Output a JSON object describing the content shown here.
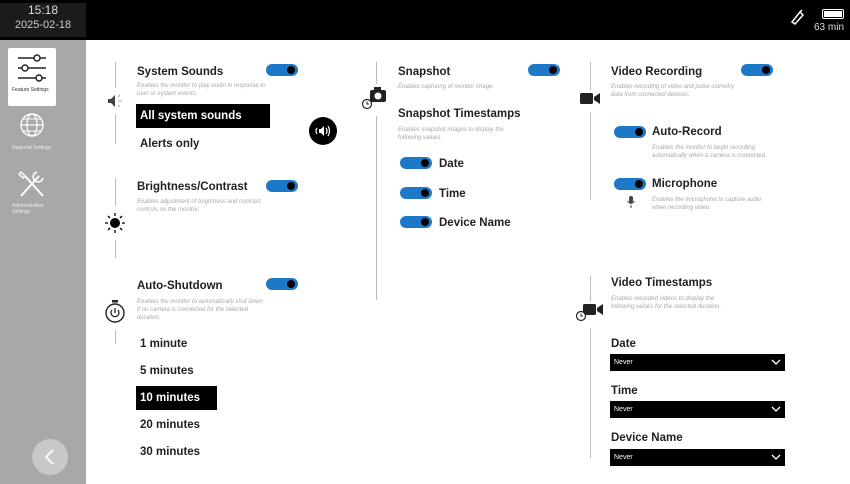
{
  "status_bar": {
    "time": "15:18",
    "date": "2025-02-18",
    "battery_remaining": "63 min"
  },
  "sidebar": {
    "items": [
      {
        "label": "Feature Settings",
        "icon": "sliders-icon",
        "active": true
      },
      {
        "label": "Regional Settings",
        "icon": "globe-icon",
        "active": false
      },
      {
        "label": "Administrative Settings",
        "icon": "tools-icon",
        "active": false
      }
    ],
    "back_icon": "chevron-left-icon"
  },
  "system_sounds": {
    "title": "System Sounds",
    "desc": "Enables the monitor to play audio in response to user or system events.",
    "enabled": true,
    "options": [
      "All system sounds",
      "Alerts only"
    ],
    "selected": "All system sounds"
  },
  "brightness": {
    "title": "Brightness/Contrast",
    "desc": "Enables adjustment of brightness and contrast controls on the monitor.",
    "enabled": true
  },
  "auto_shutdown": {
    "title": "Auto-Shutdown",
    "desc": "Enables the monitor to automatically shut down if no camera is connected for the selected duration.",
    "enabled": true,
    "options": [
      "1 minute",
      "5 minutes",
      "10 minutes",
      "20 minutes",
      "30 minutes"
    ],
    "selected": "10 minutes"
  },
  "snapshot": {
    "title": "Snapshot",
    "desc": "Enables capturing of monitor image.",
    "enabled": true
  },
  "snapshot_timestamps": {
    "title": "Snapshot Timestamps",
    "desc": "Enables snapshot images to display the following values.",
    "items": [
      {
        "label": "Date",
        "enabled": true
      },
      {
        "label": "Time",
        "enabled": true
      },
      {
        "label": "Device Name",
        "enabled": true
      }
    ]
  },
  "video_recording": {
    "title": "Video Recording",
    "desc": "Enables recording of video and pulse oximetry data from connected devices.",
    "enabled": true,
    "auto_record": {
      "title": "Auto-Record",
      "desc": "Enables the monitor to begin recording automatically when a camera is connected.",
      "enabled": true
    },
    "microphone": {
      "title": "Microphone",
      "desc": "Enables the microphone to capture audio when recording video.",
      "enabled": true
    }
  },
  "video_timestamps": {
    "title": "Video Timestamps",
    "desc": "Enables recorded videos to display the following values for the selected duration.",
    "fields": [
      {
        "label": "Date",
        "value": "Never"
      },
      {
        "label": "Time",
        "value": "Never"
      },
      {
        "label": "Device Name",
        "value": "Never"
      }
    ]
  },
  "colors": {
    "toggle_on": "#1e78c8",
    "sidebar": "#a8a8a8",
    "selected_bg": "#000000"
  }
}
